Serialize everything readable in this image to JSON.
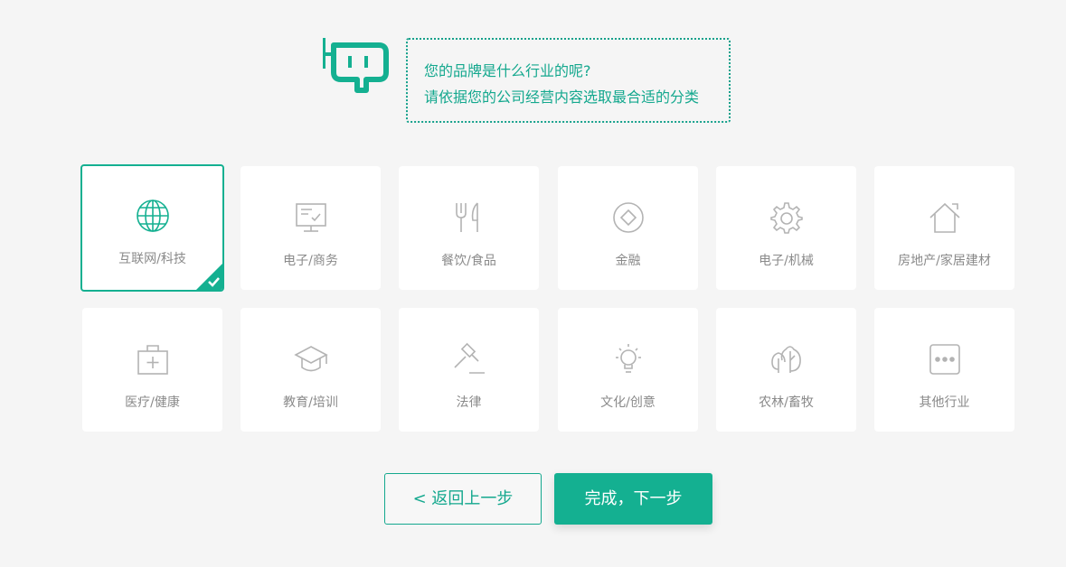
{
  "header": {
    "logo_icon": "robot-plug-logo",
    "prompt_line1": "您的品牌是什么行业的呢?",
    "prompt_line2": "请依据您的公司经营内容选取最合适的分类"
  },
  "industries": [
    {
      "label": "互联网/科技",
      "icon": "globe-icon",
      "selected": true
    },
    {
      "label": "电子/商务",
      "icon": "monitor-icon",
      "selected": false
    },
    {
      "label": "餐饮/食品",
      "icon": "fork-knife-icon",
      "selected": false
    },
    {
      "label": "金融",
      "icon": "coin-icon",
      "selected": false
    },
    {
      "label": "电子/机械",
      "icon": "gear-icon",
      "selected": false
    },
    {
      "label": "房地产/家居建材",
      "icon": "house-icon",
      "selected": false
    },
    {
      "label": "医疗/健康",
      "icon": "medical-kit-icon",
      "selected": false
    },
    {
      "label": "教育/培训",
      "icon": "graduation-cap-icon",
      "selected": false
    },
    {
      "label": "法律",
      "icon": "gavel-icon",
      "selected": false
    },
    {
      "label": "文化/创意",
      "icon": "lightbulb-icon",
      "selected": false
    },
    {
      "label": "农林/畜牧",
      "icon": "trees-icon",
      "selected": false
    },
    {
      "label": "其他行业",
      "icon": "more-dots-icon",
      "selected": false
    }
  ],
  "buttons": {
    "back_label": "< 返回上一步",
    "next_label": "完成，下一步"
  },
  "colors": {
    "accent": "#14b091",
    "icon_gray": "#b3b3b3",
    "background": "#f5f5f5"
  }
}
